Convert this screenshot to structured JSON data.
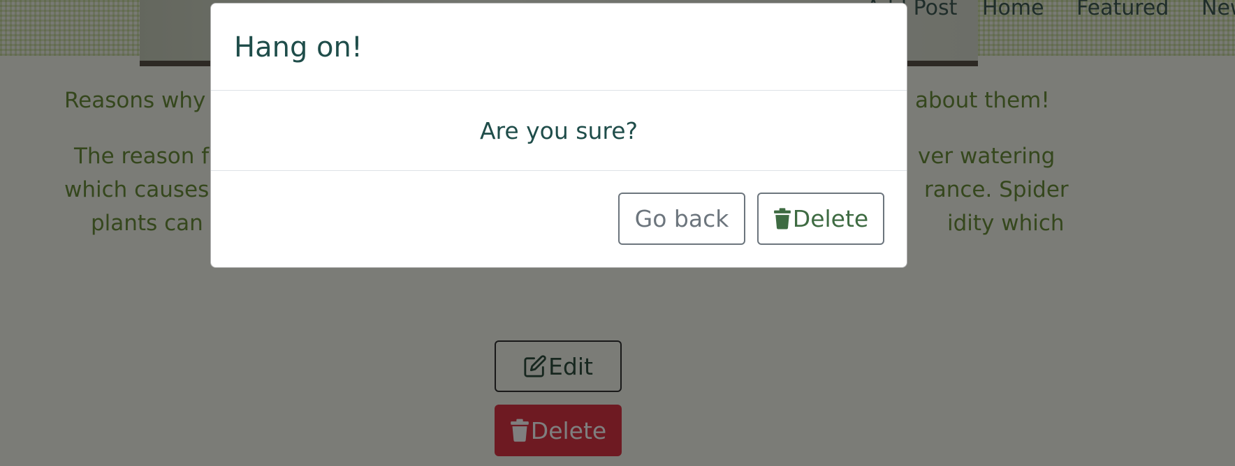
{
  "nav": {
    "items": [
      "Add Post",
      "Home",
      "Featured",
      "New"
    ]
  },
  "content": {
    "heading_left": "Reasons why",
    "heading_right": "about them!",
    "paragraph_lines": [
      "The reason f                                                                  ver watering",
      "which causes                                                                  rance. Spider",
      "plants can                                                                   idity which"
    ]
  },
  "page_actions": {
    "edit_label": "Edit",
    "delete_label": "Delete"
  },
  "modal": {
    "title": "Hang on!",
    "message": "Are you sure?",
    "go_back_label": "Go back",
    "delete_label": "Delete"
  },
  "colors": {
    "accent_green": "#3e6b42",
    "danger": "#dc3545",
    "text_teal": "#1f4d4a"
  },
  "icons": {
    "edit": "edit-icon",
    "trash": "trash-icon"
  }
}
